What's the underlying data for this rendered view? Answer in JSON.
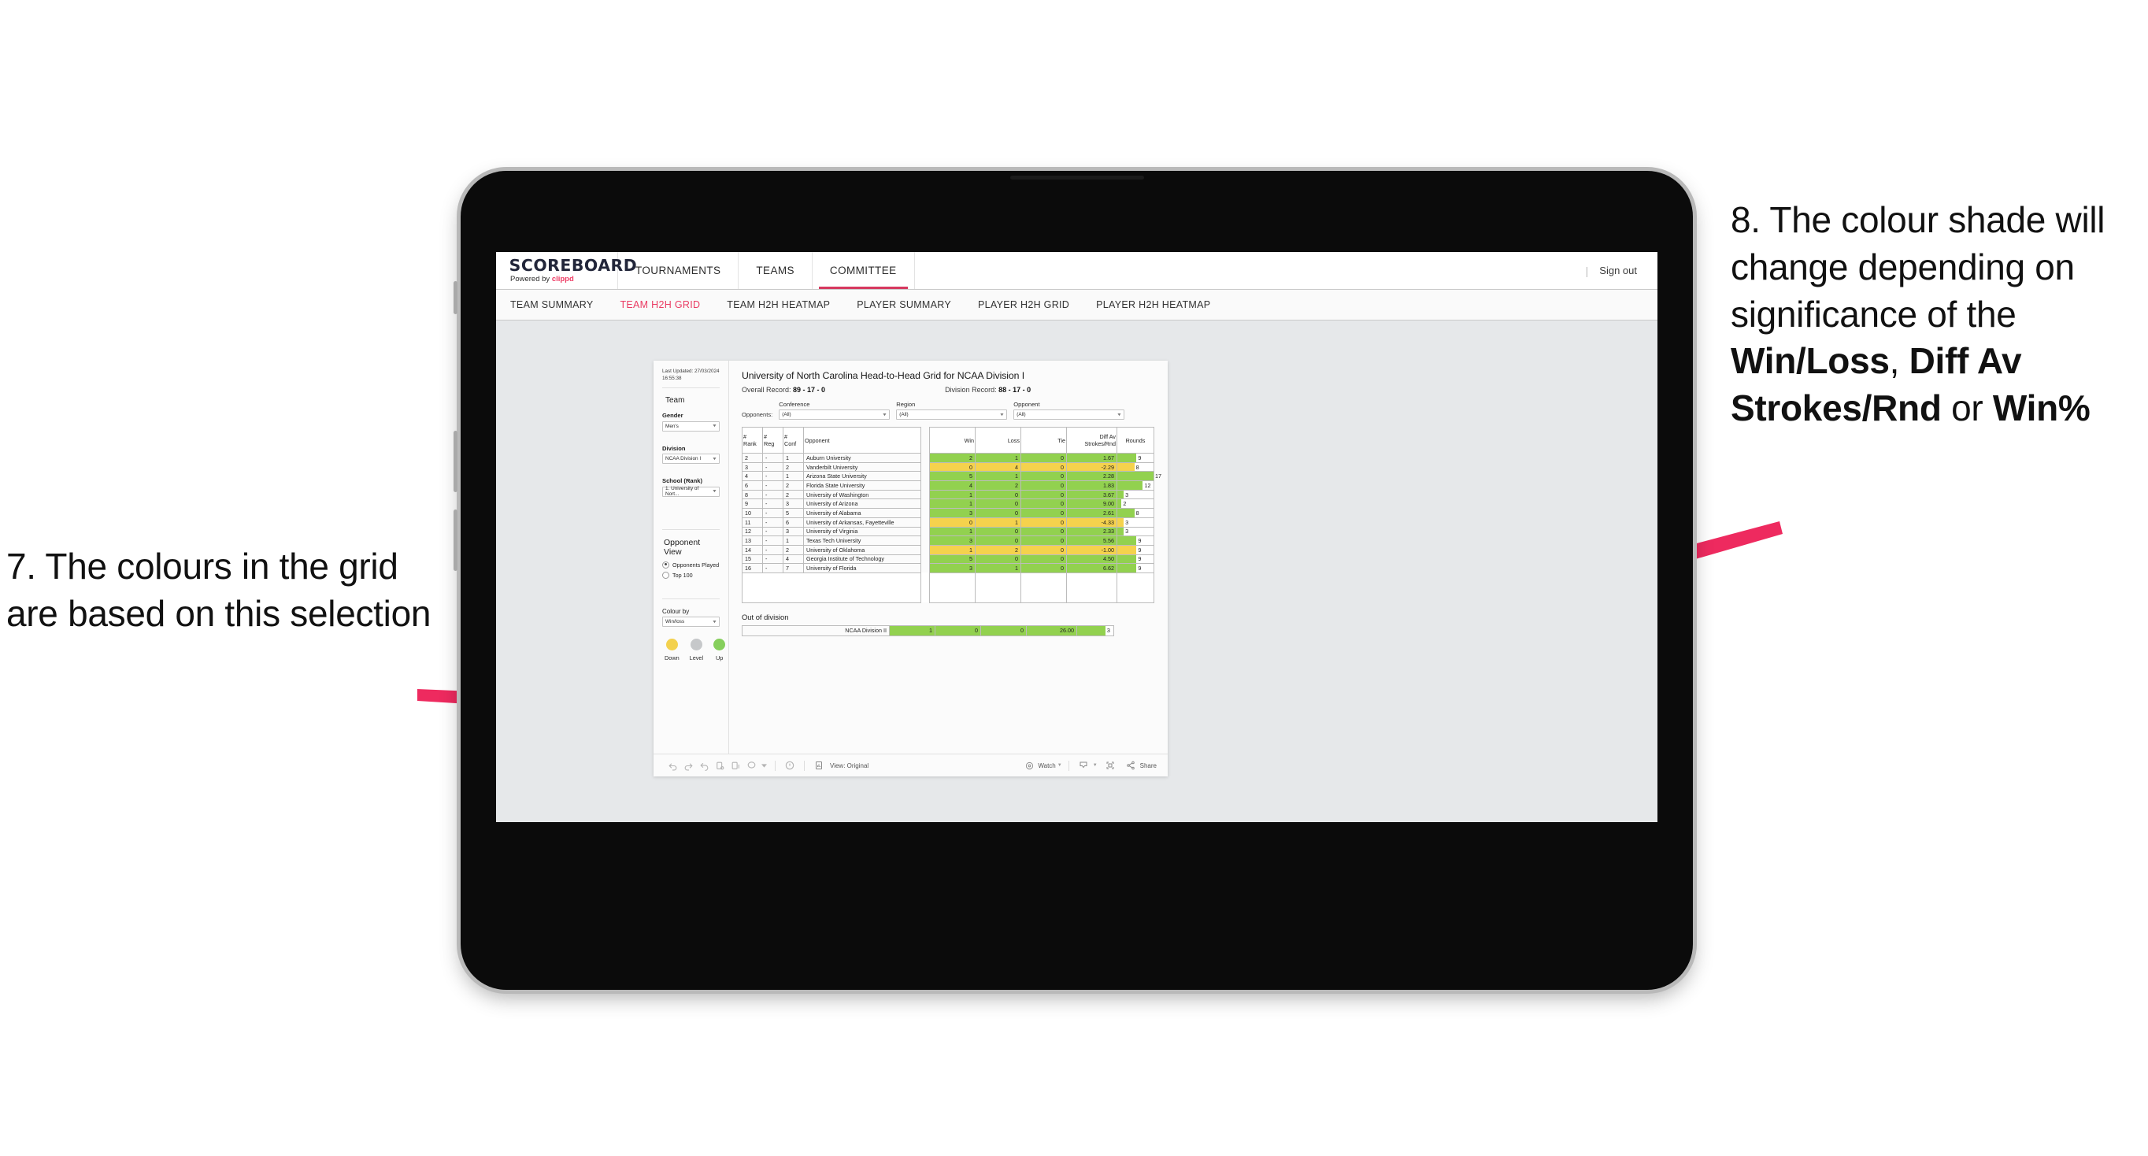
{
  "annotations": {
    "left": {
      "id": "7",
      "text": "7. The colours in the grid are based on this selection"
    },
    "right": {
      "id": "8",
      "prefix": "8. The colour shade will change depending on significance of the ",
      "bold1": "Win/Loss",
      "mid1": ", ",
      "bold2": "Diff Av Strokes/Rnd",
      "mid2": " or ",
      "bold3": "Win%"
    },
    "arrow_color": "#ee2a5f"
  },
  "topnav": {
    "logo_main": "SCOREBOARD",
    "logo_sub_prefix": "Powered by ",
    "logo_sub_brand": "clippd",
    "items": [
      {
        "label": "TOURNAMENTS",
        "active": false
      },
      {
        "label": "TEAMS",
        "active": false
      },
      {
        "label": "COMMITTEE",
        "active": true
      }
    ],
    "divider": "|",
    "sign_out": "Sign out"
  },
  "subnav": {
    "items": [
      {
        "label": "TEAM SUMMARY",
        "active": false
      },
      {
        "label": "TEAM H2H GRID",
        "active": true
      },
      {
        "label": "TEAM H2H HEATMAP",
        "active": false
      },
      {
        "label": "PLAYER SUMMARY",
        "active": false
      },
      {
        "label": "PLAYER H2H GRID",
        "active": false
      },
      {
        "label": "PLAYER H2H HEATMAP",
        "active": false
      }
    ],
    "active_color": "#ea3b63"
  },
  "sidebar": {
    "last_updated": "Last Updated: 27/03/2024 16:55:38",
    "team_heading": "Team",
    "fields": [
      {
        "label": "Gender",
        "value": "Men's"
      },
      {
        "label": "Division",
        "value": "NCAA Division I"
      },
      {
        "label": "School (Rank)",
        "value": "1. University of Nort..."
      }
    ],
    "opponent_view": {
      "heading": "Opponent View",
      "options": [
        {
          "label": "Opponents Played",
          "selected": true
        },
        {
          "label": "Top 100",
          "selected": false
        }
      ]
    },
    "colour_by": {
      "label": "Colour by",
      "value": "Win/loss"
    },
    "legend": [
      {
        "label": "Down",
        "color": "#f3d14e"
      },
      {
        "label": "Level",
        "color": "#c6c8ca"
      },
      {
        "label": "Up",
        "color": "#86cf5c"
      }
    ]
  },
  "viz": {
    "title": "University of North Carolina Head-to-Head Grid for NCAA Division I",
    "overall_label": "Overall Record: ",
    "overall_value": "89 - 17 - 0",
    "division_label": "Division Record: ",
    "division_value": "88 - 17 - 0",
    "opponents_label": "Opponents:",
    "filters": [
      {
        "label": "Conference",
        "value": "(All)"
      },
      {
        "label": "Region",
        "value": "(All)"
      },
      {
        "label": "Opponent",
        "value": "(All)"
      }
    ],
    "out_of_division_title": "Out of division"
  },
  "chart_data": {
    "type": "table",
    "title": "University of North Carolina Head-to-Head Grid for NCAA Division I",
    "columns": [
      "# Rank",
      "# Reg",
      "# Conf",
      "Opponent",
      "Win",
      "Loss",
      "Tie",
      "Diff Av Strokes/Rnd",
      "Rounds"
    ],
    "header_lines": [
      [
        "#",
        "Rank"
      ],
      [
        "#",
        "Reg"
      ],
      [
        "#",
        "Conf"
      ],
      [
        "Opponent"
      ],
      [
        "Win"
      ],
      [
        "Loss"
      ],
      [
        "Tie"
      ],
      [
        "Diff Av",
        "Strokes/Rnd"
      ],
      [
        "Rounds"
      ]
    ],
    "colors": {
      "up": "#92d14f",
      "down": "#f5d24d",
      "level": "#c6c8ca"
    },
    "rounds_max": 17,
    "rows": [
      {
        "rank": "2",
        "reg": "-",
        "conf": "1",
        "opponent": "Auburn University",
        "win": "2",
        "loss": "1",
        "tie": "0",
        "diff": "1.67",
        "rounds": "9",
        "state": "up"
      },
      {
        "rank": "3",
        "reg": "-",
        "conf": "2",
        "opponent": "Vanderbilt University",
        "win": "0",
        "loss": "4",
        "tie": "0",
        "diff": "-2.29",
        "rounds": "8",
        "state": "down"
      },
      {
        "rank": "4",
        "reg": "-",
        "conf": "1",
        "opponent": "Arizona State University",
        "win": "5",
        "loss": "1",
        "tie": "0",
        "diff": "2.28",
        "rounds": "17",
        "state": "up"
      },
      {
        "rank": "6",
        "reg": "-",
        "conf": "2",
        "opponent": "Florida State University",
        "win": "4",
        "loss": "2",
        "tie": "0",
        "diff": "1.83",
        "rounds": "12",
        "state": "up"
      },
      {
        "rank": "8",
        "reg": "-",
        "conf": "2",
        "opponent": "University of Washington",
        "win": "1",
        "loss": "0",
        "tie": "0",
        "diff": "3.67",
        "rounds": "3",
        "state": "up"
      },
      {
        "rank": "9",
        "reg": "-",
        "conf": "3",
        "opponent": "University of Arizona",
        "win": "1",
        "loss": "0",
        "tie": "0",
        "diff": "9.00",
        "rounds": "2",
        "state": "up"
      },
      {
        "rank": "10",
        "reg": "-",
        "conf": "5",
        "opponent": "University of Alabama",
        "win": "3",
        "loss": "0",
        "tie": "0",
        "diff": "2.61",
        "rounds": "8",
        "state": "up"
      },
      {
        "rank": "11",
        "reg": "-",
        "conf": "6",
        "opponent": "University of Arkansas, Fayetteville",
        "win": "0",
        "loss": "1",
        "tie": "0",
        "diff": "-4.33",
        "rounds": "3",
        "state": "down"
      },
      {
        "rank": "12",
        "reg": "-",
        "conf": "3",
        "opponent": "University of Virginia",
        "win": "1",
        "loss": "0",
        "tie": "0",
        "diff": "2.33",
        "rounds": "3",
        "state": "up"
      },
      {
        "rank": "13",
        "reg": "-",
        "conf": "1",
        "opponent": "Texas Tech University",
        "win": "3",
        "loss": "0",
        "tie": "0",
        "diff": "5.56",
        "rounds": "9",
        "state": "up"
      },
      {
        "rank": "14",
        "reg": "-",
        "conf": "2",
        "opponent": "University of Oklahoma",
        "win": "1",
        "loss": "2",
        "tie": "0",
        "diff": "-1.00",
        "rounds": "9",
        "state": "down"
      },
      {
        "rank": "15",
        "reg": "-",
        "conf": "4",
        "opponent": "Georgia Institute of Technology",
        "win": "5",
        "loss": "0",
        "tie": "0",
        "diff": "4.50",
        "rounds": "9",
        "state": "up"
      },
      {
        "rank": "16",
        "reg": "-",
        "conf": "7",
        "opponent": "University of Florida",
        "win": "3",
        "loss": "1",
        "tie": "0",
        "diff": "6.62",
        "rounds": "9",
        "state": "up"
      }
    ],
    "out_of_division": {
      "label": "NCAA Division II",
      "win": "1",
      "loss": "0",
      "tie": "0",
      "diff": "26.00",
      "rounds": "3",
      "state": "up"
    }
  },
  "toolbar": {
    "icons": [
      "undo-icon",
      "redo-icon",
      "revert-icon",
      "refresh-icon",
      "pause-icon",
      "comment-icon",
      "alert-icon"
    ],
    "view_label": "View: Original",
    "watch_label": "Watch",
    "share_label": "Share"
  }
}
